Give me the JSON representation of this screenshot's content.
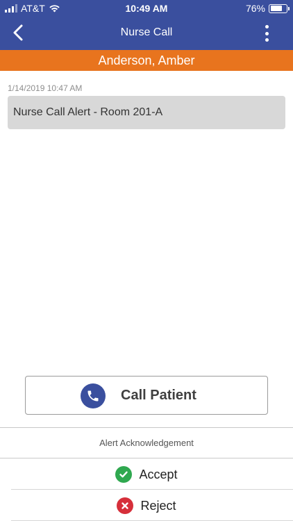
{
  "status_bar": {
    "carrier": "AT&T",
    "time": "10:49 AM",
    "battery_percent": "76%",
    "battery_level": 0.76,
    "signal_bars_active": 3
  },
  "nav": {
    "title": "Nurse Call",
    "back_icon": "chevron-left-icon",
    "menu_icon": "more-vertical-icon"
  },
  "patient": {
    "name": "Anderson, Amber"
  },
  "alert": {
    "timestamp": "1/14/2019 10:47 AM",
    "message": "Nurse Call Alert - Room 201-A"
  },
  "call": {
    "label": "Call Patient",
    "icon": "phone-icon"
  },
  "acknowledgement": {
    "title": "Alert Acknowledgement",
    "accept_label": "Accept",
    "reject_label": "Reject"
  },
  "colors": {
    "header": "#3a4f9e",
    "patient_bar": "#e8741e",
    "accept": "#2fa84f",
    "reject": "#d62f3a"
  }
}
